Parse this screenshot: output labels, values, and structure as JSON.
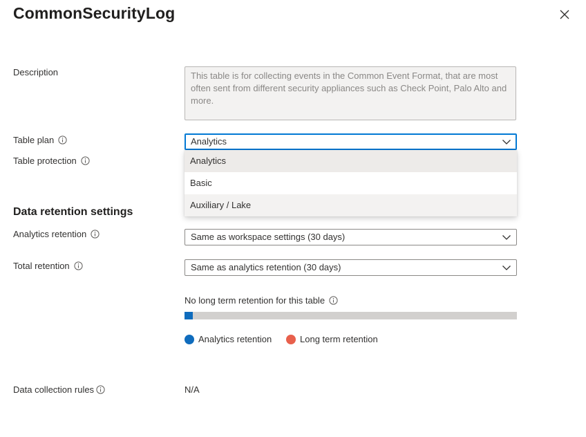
{
  "panel": {
    "title": "CommonSecurityLog"
  },
  "description": {
    "label": "Description",
    "text": "This table is for collecting events in the Common Event Format, that are most often sent from different security appliances such as Check Point, Palo Alto and more."
  },
  "table_plan": {
    "label": "Table plan",
    "selected": "Analytics",
    "options": [
      "Analytics",
      "Basic",
      "Auxiliary / Lake"
    ]
  },
  "table_protection": {
    "label": "Table protection"
  },
  "retention": {
    "section_title": "Data retention settings",
    "analytics_label": "Analytics retention",
    "analytics_value": "Same as workspace settings (30 days)",
    "total_label": "Total retention",
    "total_value": "Same as analytics retention (30 days)",
    "summary_text": "No long term retention for this table",
    "analytics_fraction": 0.025,
    "legend": {
      "analytics": "Analytics retention",
      "long_term": "Long term retention"
    },
    "colors": {
      "analytics": "#0f6cbd",
      "long_term": "#e8604c",
      "track": "#d2d0ce"
    }
  },
  "dcr": {
    "label": "Data collection rules",
    "value": "N/A"
  },
  "icons": [
    "close-icon",
    "info-icon",
    "chevron-down-icon"
  ]
}
